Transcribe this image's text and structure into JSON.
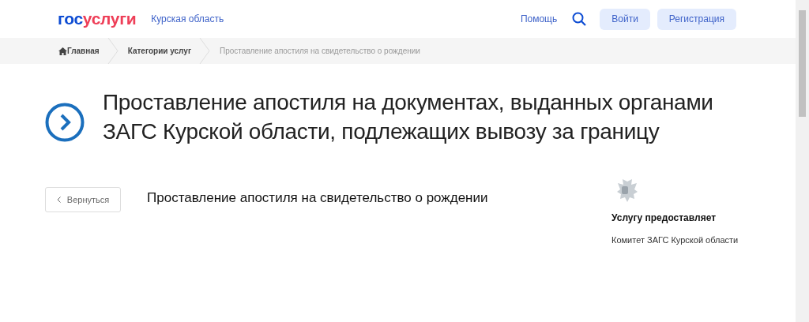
{
  "header": {
    "logo": {
      "prefix": "гос",
      "suffix": "услуги"
    },
    "region": "Курская область",
    "help": "Помощь",
    "buttons": [
      "Войти",
      "Регистрация"
    ]
  },
  "breadcrumbs": [
    {
      "label": "Главная",
      "kind": "home"
    },
    {
      "label": "Категории услуг",
      "kind": "link"
    },
    {
      "label": "Проставление апостиля на свидетельство о рождении",
      "kind": "current"
    }
  ],
  "title": "Проставление апостиля на документах, выданных органами ЗАГС Курской области, подлежащих вывозу за границу",
  "back_button": "Вернуться",
  "service_name": "Проставление апостиля на свидетельство о рождении",
  "provider": {
    "heading": "Услугу предоставляет",
    "name": "Комитет ЗАГС Курской области"
  }
}
